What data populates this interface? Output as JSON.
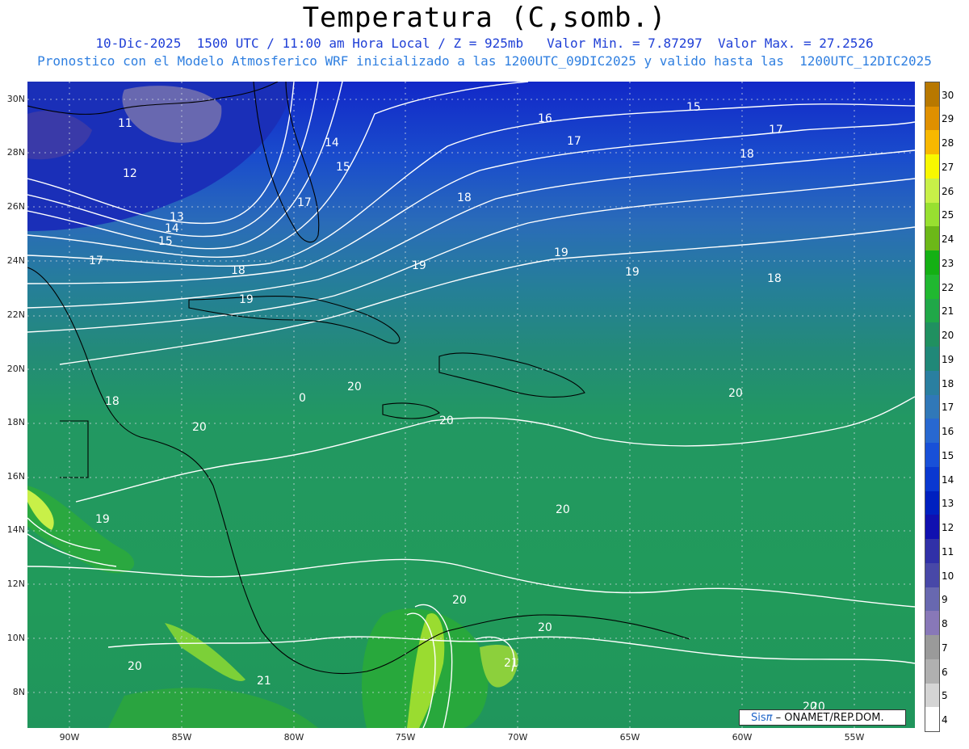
{
  "header": {
    "title": "Temperatura (C,somb.)",
    "line1": "10-Dic-2025  1500 UTC / 11:00 am Hora Local / Z = 925mb   Valor Min. = 7.87297  Valor Max. = 27.2526",
    "line2": "Pronostico con el Modelo Atmosferico WRF inicializado a las 1200UTC_09DIC2025 y valido hasta las  1200UTC_12DIC2025"
  },
  "axes": {
    "lat_ticks": [
      "30N",
      "28N",
      "26N",
      "24N",
      "22N",
      "20N",
      "18N",
      "16N",
      "14N",
      "12N",
      "10N",
      "8N"
    ],
    "lon_ticks": [
      "90W",
      "85W",
      "80W",
      "75W",
      "70W",
      "65W",
      "60W",
      "55W"
    ]
  },
  "colorbar": {
    "labels": [
      "30",
      "29",
      "28",
      "27",
      "26",
      "25",
      "24",
      "23",
      "22",
      "21",
      "20",
      "19",
      "18",
      "17",
      "16",
      "15",
      "14",
      "13",
      "12",
      "11",
      "10",
      "9",
      "8",
      "7",
      "6",
      "5",
      "4"
    ],
    "colors": [
      "#b87800",
      "#e09000",
      "#f8b800",
      "#f8f800",
      "#c8f048",
      "#98e030",
      "#6cb818",
      "#14b014",
      "#20b830",
      "#20a848",
      "#209060",
      "#208878",
      "#2a7fa0",
      "#3078b8",
      "#2868d0",
      "#1850d8",
      "#0a38d0",
      "#0020c0",
      "#1010b0",
      "#3030a8",
      "#4848a8",
      "#6868b0",
      "#8878b8",
      "#9a9a9a",
      "#b0b0b0",
      "#d4d4d4",
      "#ffffff"
    ]
  },
  "contour_labels": [
    "11",
    "12",
    "13",
    "14",
    "15",
    "17",
    "14",
    "15",
    "16",
    "17",
    "15",
    "17",
    "18",
    "17",
    "18",
    "18",
    "18",
    "19",
    "19",
    "19",
    "18",
    "19",
    "20",
    "20",
    "20",
    "20",
    "20",
    "19",
    "20",
    "20",
    "20",
    "21",
    "20",
    "21",
    "20",
    "0"
  ],
  "credit": {
    "sis": "Sis",
    "pi": "π",
    "text": "– ONAMET/REP.DOM."
  },
  "colors": {
    "title_line1": "#1f3fd6",
    "title_line2": "#2f7fe0"
  }
}
